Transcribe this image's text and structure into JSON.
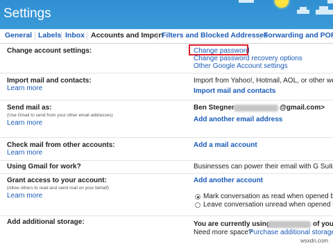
{
  "header": {
    "title": "Settings"
  },
  "tabs": [
    {
      "label": "General"
    },
    {
      "label": "Labels"
    },
    {
      "label": "Inbox"
    },
    {
      "label": "Accounts and Import"
    },
    {
      "label": "Filters and Blocked Addresses"
    },
    {
      "label": "Forwarding and POP/IM"
    }
  ],
  "rows": {
    "change_account": {
      "label": "Change account settings:",
      "links": [
        "Change password",
        "Change password recovery options",
        "Other Google Account settings"
      ]
    },
    "import_mail": {
      "label": "Import mail and contacts:",
      "learn": "Learn more",
      "text": "Import from Yahoo!, Hotmail, AOL, or other webm",
      "link": "Import mail and contacts"
    },
    "send_mail": {
      "label": "Send mail as:",
      "sub": "(Use Gmail to send from your other email addresses)",
      "learn": "Learn more",
      "name": "Ben Stegner",
      "email_suffix": "@gmail.com>",
      "link": "Add another email address"
    },
    "check_mail": {
      "label": "Check mail from other accounts:",
      "learn": "Learn more",
      "link": "Add a mail account"
    },
    "gmail_work": {
      "label": "Using Gmail for work?",
      "text": "Businesses can power their email with G Suite. Le"
    },
    "grant_access": {
      "label": "Grant access to your account:",
      "sub": "(Allow others to read and send mail on your behalf)",
      "learn": "Learn more",
      "link": "Add another account",
      "options": [
        "Mark conversation as read when opened by",
        "Leave conversation unread when opened by"
      ]
    },
    "storage": {
      "label": "Add additional storage:",
      "text_a": "You are currently using",
      "text_b": "of you",
      "need_more": "Need more space?",
      "purchase": "Purchase additional storage"
    }
  },
  "watermark": "wsxdn.com"
}
